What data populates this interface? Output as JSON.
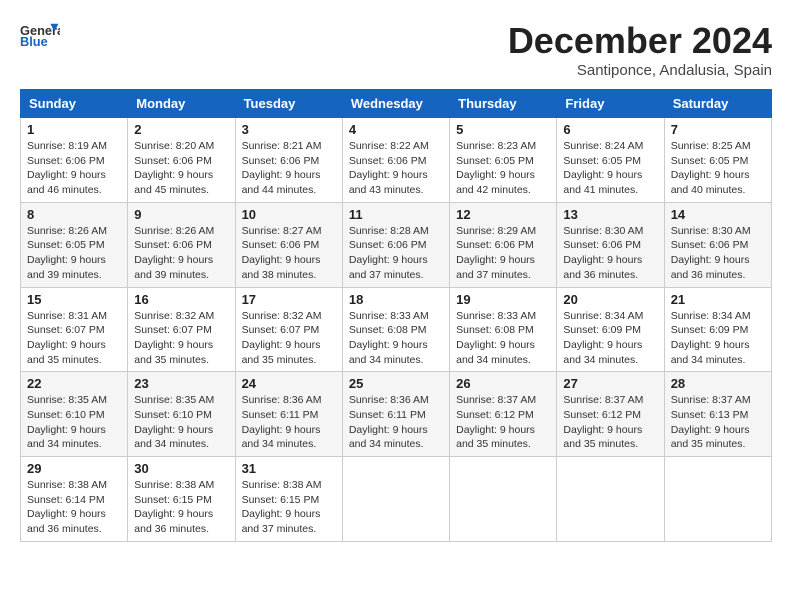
{
  "logo": {
    "general": "General",
    "blue": "Blue"
  },
  "title": "December 2024",
  "subtitle": "Santiponce, Andalusia, Spain",
  "days_header": [
    "Sunday",
    "Monday",
    "Tuesday",
    "Wednesday",
    "Thursday",
    "Friday",
    "Saturday"
  ],
  "weeks": [
    {
      "row_class": "odd-row",
      "days": [
        {
          "num": "1",
          "detail": "Sunrise: 8:19 AM\nSunset: 6:06 PM\nDaylight: 9 hours\nand 46 minutes."
        },
        {
          "num": "2",
          "detail": "Sunrise: 8:20 AM\nSunset: 6:06 PM\nDaylight: 9 hours\nand 45 minutes."
        },
        {
          "num": "3",
          "detail": "Sunrise: 8:21 AM\nSunset: 6:06 PM\nDaylight: 9 hours\nand 44 minutes."
        },
        {
          "num": "4",
          "detail": "Sunrise: 8:22 AM\nSunset: 6:06 PM\nDaylight: 9 hours\nand 43 minutes."
        },
        {
          "num": "5",
          "detail": "Sunrise: 8:23 AM\nSunset: 6:05 PM\nDaylight: 9 hours\nand 42 minutes."
        },
        {
          "num": "6",
          "detail": "Sunrise: 8:24 AM\nSunset: 6:05 PM\nDaylight: 9 hours\nand 41 minutes."
        },
        {
          "num": "7",
          "detail": "Sunrise: 8:25 AM\nSunset: 6:05 PM\nDaylight: 9 hours\nand 40 minutes."
        }
      ]
    },
    {
      "row_class": "even-row",
      "days": [
        {
          "num": "8",
          "detail": "Sunrise: 8:26 AM\nSunset: 6:05 PM\nDaylight: 9 hours\nand 39 minutes."
        },
        {
          "num": "9",
          "detail": "Sunrise: 8:26 AM\nSunset: 6:06 PM\nDaylight: 9 hours\nand 39 minutes."
        },
        {
          "num": "10",
          "detail": "Sunrise: 8:27 AM\nSunset: 6:06 PM\nDaylight: 9 hours\nand 38 minutes."
        },
        {
          "num": "11",
          "detail": "Sunrise: 8:28 AM\nSunset: 6:06 PM\nDaylight: 9 hours\nand 37 minutes."
        },
        {
          "num": "12",
          "detail": "Sunrise: 8:29 AM\nSunset: 6:06 PM\nDaylight: 9 hours\nand 37 minutes."
        },
        {
          "num": "13",
          "detail": "Sunrise: 8:30 AM\nSunset: 6:06 PM\nDaylight: 9 hours\nand 36 minutes."
        },
        {
          "num": "14",
          "detail": "Sunrise: 8:30 AM\nSunset: 6:06 PM\nDaylight: 9 hours\nand 36 minutes."
        }
      ]
    },
    {
      "row_class": "odd-row",
      "days": [
        {
          "num": "15",
          "detail": "Sunrise: 8:31 AM\nSunset: 6:07 PM\nDaylight: 9 hours\nand 35 minutes."
        },
        {
          "num": "16",
          "detail": "Sunrise: 8:32 AM\nSunset: 6:07 PM\nDaylight: 9 hours\nand 35 minutes."
        },
        {
          "num": "17",
          "detail": "Sunrise: 8:32 AM\nSunset: 6:07 PM\nDaylight: 9 hours\nand 35 minutes."
        },
        {
          "num": "18",
          "detail": "Sunrise: 8:33 AM\nSunset: 6:08 PM\nDaylight: 9 hours\nand 34 minutes."
        },
        {
          "num": "19",
          "detail": "Sunrise: 8:33 AM\nSunset: 6:08 PM\nDaylight: 9 hours\nand 34 minutes."
        },
        {
          "num": "20",
          "detail": "Sunrise: 8:34 AM\nSunset: 6:09 PM\nDaylight: 9 hours\nand 34 minutes."
        },
        {
          "num": "21",
          "detail": "Sunrise: 8:34 AM\nSunset: 6:09 PM\nDaylight: 9 hours\nand 34 minutes."
        }
      ]
    },
    {
      "row_class": "even-row",
      "days": [
        {
          "num": "22",
          "detail": "Sunrise: 8:35 AM\nSunset: 6:10 PM\nDaylight: 9 hours\nand 34 minutes."
        },
        {
          "num": "23",
          "detail": "Sunrise: 8:35 AM\nSunset: 6:10 PM\nDaylight: 9 hours\nand 34 minutes."
        },
        {
          "num": "24",
          "detail": "Sunrise: 8:36 AM\nSunset: 6:11 PM\nDaylight: 9 hours\nand 34 minutes."
        },
        {
          "num": "25",
          "detail": "Sunrise: 8:36 AM\nSunset: 6:11 PM\nDaylight: 9 hours\nand 34 minutes."
        },
        {
          "num": "26",
          "detail": "Sunrise: 8:37 AM\nSunset: 6:12 PM\nDaylight: 9 hours\nand 35 minutes."
        },
        {
          "num": "27",
          "detail": "Sunrise: 8:37 AM\nSunset: 6:12 PM\nDaylight: 9 hours\nand 35 minutes."
        },
        {
          "num": "28",
          "detail": "Sunrise: 8:37 AM\nSunset: 6:13 PM\nDaylight: 9 hours\nand 35 minutes."
        }
      ]
    },
    {
      "row_class": "odd-row",
      "days": [
        {
          "num": "29",
          "detail": "Sunrise: 8:38 AM\nSunset: 6:14 PM\nDaylight: 9 hours\nand 36 minutes."
        },
        {
          "num": "30",
          "detail": "Sunrise: 8:38 AM\nSunset: 6:15 PM\nDaylight: 9 hours\nand 36 minutes."
        },
        {
          "num": "31",
          "detail": "Sunrise: 8:38 AM\nSunset: 6:15 PM\nDaylight: 9 hours\nand 37 minutes."
        },
        {
          "num": "",
          "detail": ""
        },
        {
          "num": "",
          "detail": ""
        },
        {
          "num": "",
          "detail": ""
        },
        {
          "num": "",
          "detail": ""
        }
      ]
    }
  ]
}
